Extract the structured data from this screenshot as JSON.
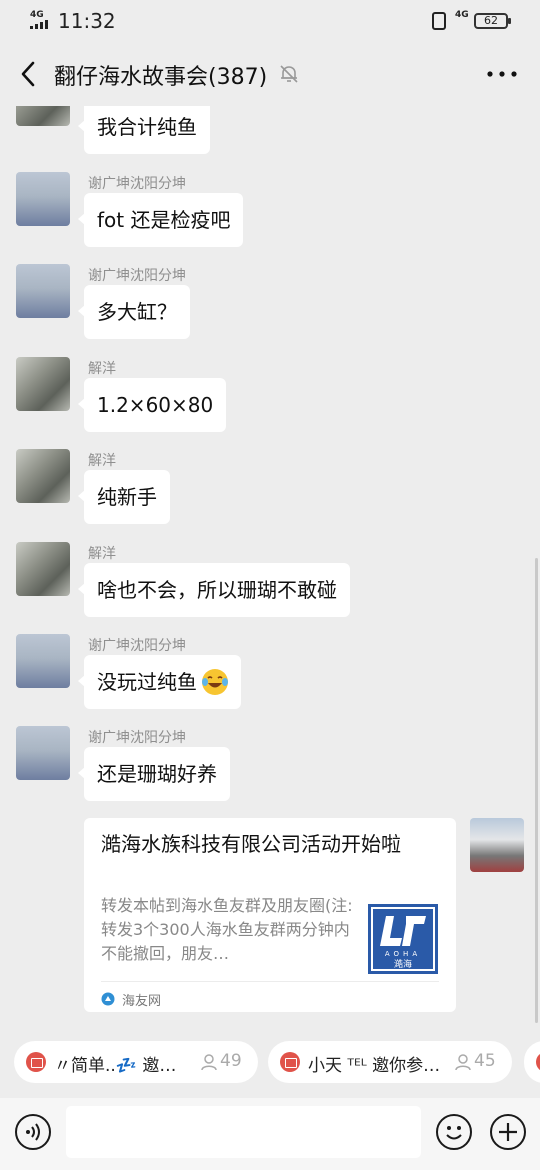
{
  "status_bar": {
    "network_left": "4G",
    "time": "11:32",
    "network_right": "4G",
    "battery": "62"
  },
  "header": {
    "title": "翻仔海水故事会(387)"
  },
  "messages": [
    {
      "sender": "",
      "text": "我合计纯鱼"
    },
    {
      "sender": "谢广坤沈阳分坤",
      "text": "fot 还是检疫吧"
    },
    {
      "sender": "谢广坤沈阳分坤",
      "text": "多大缸？"
    },
    {
      "sender": "解洋",
      "text": "1.2×60×80"
    },
    {
      "sender": "解洋",
      "text": "纯新手"
    },
    {
      "sender": "解洋",
      "text": "啥也不会，所以珊瑚不敢碰"
    },
    {
      "sender": "谢广坤沈阳分坤",
      "text": "没玩过纯鱼"
    },
    {
      "sender": "谢广坤沈阳分坤",
      "text": "还是珊瑚好养"
    }
  ],
  "link_card": {
    "title": "澔海水族科技有限公司活动开始啦",
    "description": "转发本帖到海水鱼友群及朋友圈(注:转发3个300人海水鱼友群两分钟内不能撤回，朋友…",
    "thumb_brand": "AOHA",
    "thumb_cn": "澔海",
    "source": "海友网"
  },
  "activity_chips": [
    {
      "text": "〃简单..💤 邀…",
      "count": "49"
    },
    {
      "text": "小天 ᵀᴱᴸ 邀你参…",
      "count": "45"
    }
  ],
  "colors": {
    "background": "#ededed",
    "bubble": "#ffffff",
    "gift": "#e0534a",
    "thumb": "#2a5aa8"
  }
}
